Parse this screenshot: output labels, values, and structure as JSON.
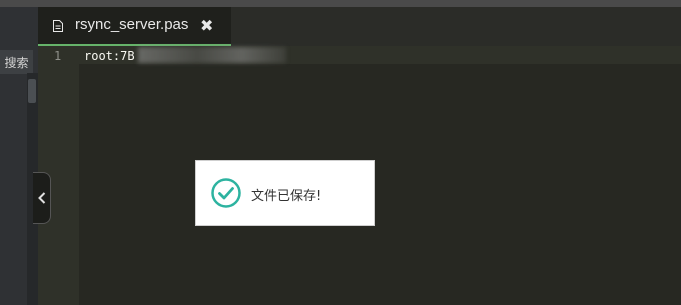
{
  "left_panel": {
    "search_label": "搜索"
  },
  "tab": {
    "title": "rsync_server.pas",
    "close_glyph": "✖",
    "icon": "file-doc-icon"
  },
  "editor": {
    "lines": [
      {
        "number": "1",
        "text": "root:7B"
      }
    ]
  },
  "sidebar_toggle": {
    "glyph": "‹",
    "icon": "chevron-left-icon"
  },
  "toast": {
    "message": "文件已保存!",
    "icon": "check-circle-icon",
    "accent": "#2db3a0"
  },
  "colors": {
    "editor_bg": "#272822",
    "tab_underline": "#66b36a"
  }
}
